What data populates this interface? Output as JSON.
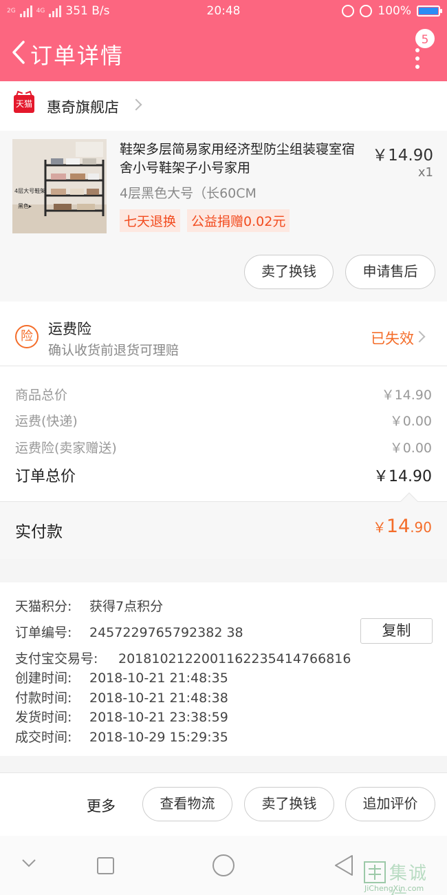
{
  "status_bar": {
    "network_left": "2G",
    "network_right": "4G",
    "speed": "351 B/s",
    "time": "20:48",
    "battery_text": "100%",
    "battery_level": 1.0
  },
  "header": {
    "title": "订单详情",
    "notification_count": "5"
  },
  "store": {
    "logo_text": "天猫",
    "name": "惠奇旗舰店"
  },
  "product": {
    "title": "鞋架多层简易家用经济型防尘组装寝室宿舍小号鞋架子小号家用",
    "price": "￥14.90",
    "quantity": "x1",
    "sku": "4层黑色大号（长60CM",
    "tags": [
      "七天退换",
      "公益捐赠0.02元"
    ],
    "thumb_caption_1": "4层大号鞋架",
    "thumb_caption_2": "黑色▸",
    "buttons": [
      "卖了换钱",
      "申请售后"
    ]
  },
  "insurance": {
    "icon_text": "险",
    "title": "运费险",
    "subtitle": "确认收货前退货可理赔",
    "status": "已失效"
  },
  "summary": {
    "rows": [
      {
        "label": "商品总价",
        "value": "￥14.90"
      },
      {
        "label": "运费(快递)",
        "value": "￥0.00"
      },
      {
        "label": "运费险(卖家赠送)",
        "value": "￥0.00"
      }
    ],
    "total_label": "订单总价",
    "total_value": "￥14.90",
    "paid_label": "实付款",
    "paid_currency": "￥",
    "paid_int": "14",
    "paid_dec": ".90"
  },
  "order_info": {
    "points_label": "天猫积分:",
    "points_value": "获得7点积分",
    "order_no_label": "订单编号:",
    "order_no_value": "2457229765792382 38",
    "copy_button": "复制",
    "alipay_label": "支付宝交易号:",
    "alipay_value": "2018102122001162235414766816",
    "created_label": "创建时间:",
    "created_value": "2018-10-21 21:48:35",
    "paid_label": "付款时间:",
    "paid_value": "2018-10-21 21:48:38",
    "shipped_label": "发货时间:",
    "shipped_value": "2018-10-21 23:38:59",
    "closed_label": "成交时间:",
    "closed_value": "2018-10-29 15:29:35"
  },
  "actions": {
    "more": "更多",
    "buttons": [
      "查看物流",
      "卖了换钱",
      "追加评价"
    ]
  },
  "watermark": {
    "cn": "集诚信",
    "en": "JiChengXin.com"
  },
  "colors": {
    "header": "#fc6680",
    "accent_orange": "#f46d2a",
    "tag_red": "#f24b1e"
  }
}
